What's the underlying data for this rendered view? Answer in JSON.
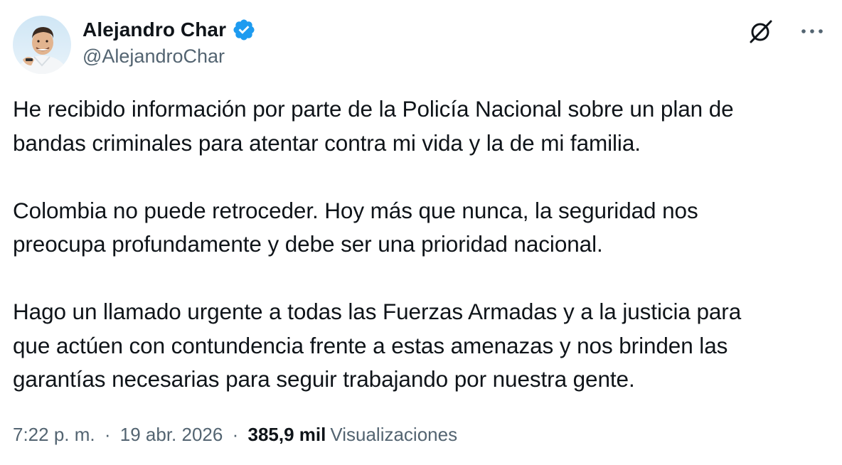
{
  "author": {
    "display_name": "Alejandro Char",
    "handle": "@AlejandroChar",
    "verified": true,
    "verified_color": "#1d9bf0"
  },
  "actions": {
    "grok_icon": "grok-icon",
    "more_icon": "more-options-icon"
  },
  "tweet": {
    "paragraphs": [
      {
        "lines": [
          "He recibido información por parte de la Policía Nacional sobre un plan de",
          "bandas criminales para atentar contra mi vida y la de mi familia."
        ]
      },
      {
        "lines": [
          "Colombia no puede retroceder. Hoy más que nunca, la seguridad nos",
          "preocupa profundamente y debe ser una prioridad nacional."
        ]
      },
      {
        "lines": [
          "Hago un llamado urgente a todas las Fuerzas Armadas y a la justicia para",
          "que actúen con contundencia frente a estas amenazas y nos brinden las",
          "garantías necesarias para seguir trabajando por nuestra gente."
        ]
      }
    ]
  },
  "meta": {
    "time": "7:22 p. m.",
    "separator": "·",
    "date": "19 abr. 2026",
    "views_count": "385,9 mil",
    "views_label": "Visualizaciones"
  }
}
